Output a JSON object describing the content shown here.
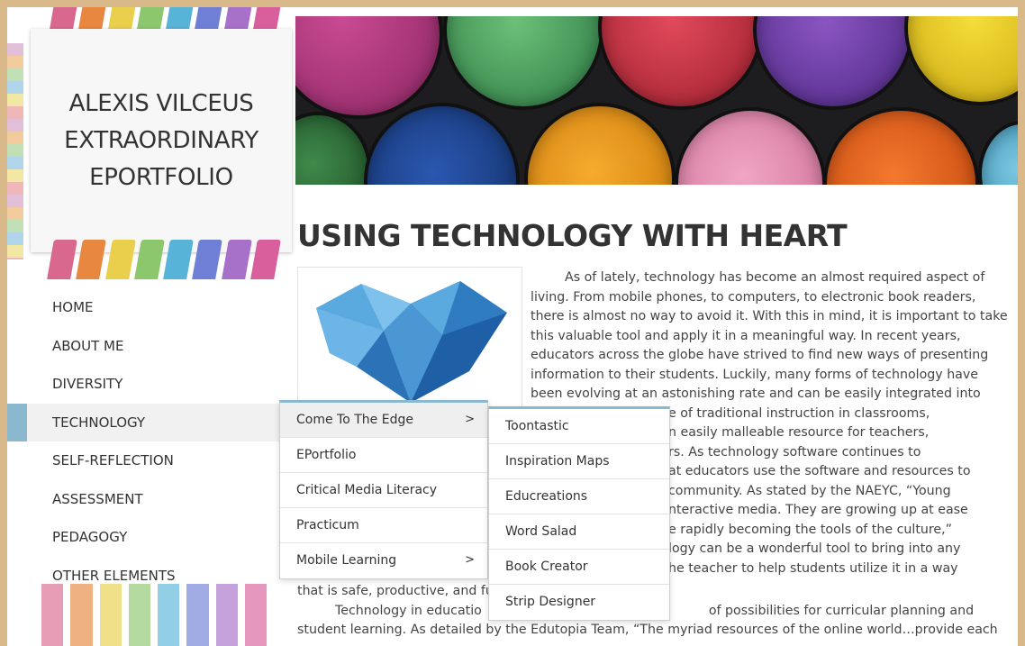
{
  "site": {
    "title_lines": [
      "ALEXIS VILCEUS",
      "EXTRAORDINARY",
      "EPORTFOLIO"
    ],
    "stripe_colors": [
      "#d9688e",
      "#e8873f",
      "#e9cf4c",
      "#8cc66d",
      "#58b3d8",
      "#6f7fd6",
      "#a770c9",
      "#d85f9b"
    ]
  },
  "nav": {
    "items": [
      {
        "label": "HOME"
      },
      {
        "label": "ABOUT ME"
      },
      {
        "label": "DIVERSITY"
      },
      {
        "label": "TECHNOLOGY",
        "active": true
      },
      {
        "label": "SELF-REFLECTION"
      },
      {
        "label": "ASSESSMENT"
      },
      {
        "label": "PEDAGOGY"
      },
      {
        "label": "OTHER ELEMENTS"
      }
    ]
  },
  "submenu": {
    "items": [
      {
        "label": "Come To The Edge",
        "arrow": ">"
      },
      {
        "label": "EPortfolio"
      },
      {
        "label": "Critical Media Literacy"
      },
      {
        "label": "Practicum"
      },
      {
        "label": "Mobile Learning",
        "arrow": ">"
      }
    ]
  },
  "subsubmenu": {
    "items": [
      {
        "label": "Toontastic"
      },
      {
        "label": "Inspiration Maps"
      },
      {
        "label": "Educreations"
      },
      {
        "label": "Word Salad"
      },
      {
        "label": "Book Creator"
      },
      {
        "label": "Strip Designer"
      }
    ]
  },
  "page": {
    "heading": "USING TECHNOLOGY WITH HEART",
    "paragraph_lines": [
      "As of lately, technology has become an almost required aspect of",
      "living. From mobile phones, to computers, to electronic book readers,",
      "there is almost no way to avoid it. With this in mind, it is important to take",
      "this valuable tool and apply it in a meaningful way. In recent years,",
      "educators across the globe have strived to find new ways of presenting",
      "information to their students. Luckily, many forms of technology have",
      "been evolving at an astonishing rate and can be easily integrated into",
      "e of traditional instruction in classrooms,",
      "n easily malleable resource for teachers,",
      "rs. As technology software continues to",
      "at educators use the software and resources to",
      "community. As stated by the NAEYC, “Young",
      "nteractive media. They are growing up at ease",
      "e rapidly becoming the tools of the culture,”",
      "logy can be a wonderful tool to bring into any",
      "he teacher to help students utilize it in a way"
    ],
    "lower_lines": [
      "that is safe, productive, and fu",
      "Technology in educatio",
      "of possibilities for curricular planning and",
      "student learning. As detailed by the Edutopia Team, “The myriad resources of the online world…provide each"
    ]
  }
}
